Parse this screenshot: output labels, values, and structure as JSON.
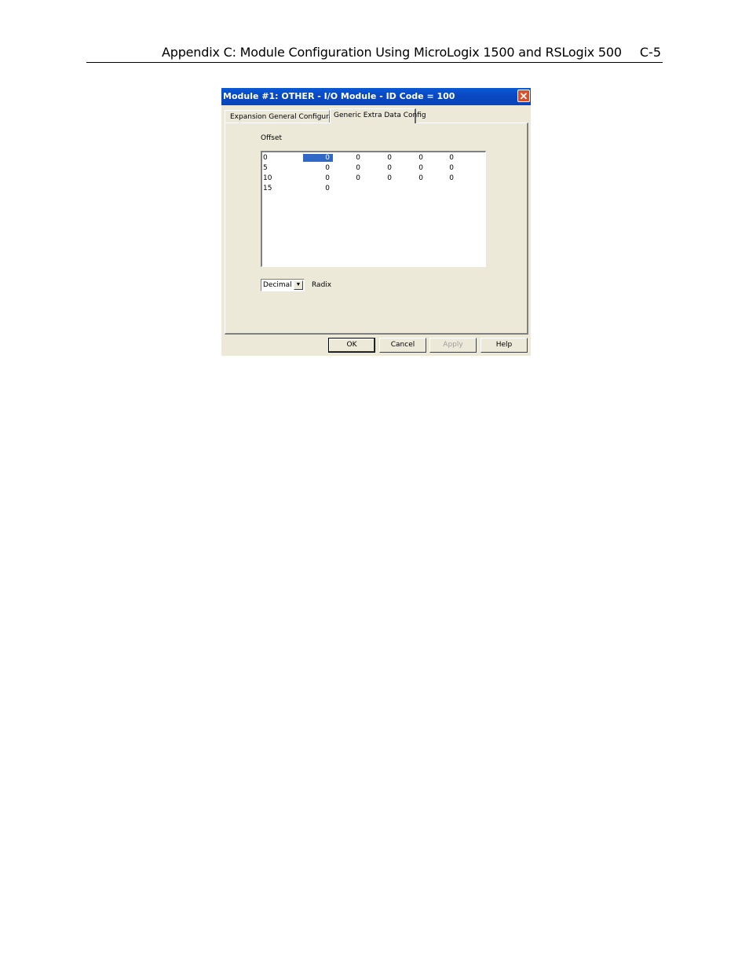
{
  "page": {
    "header_title": "Appendix C:  Module Configuration Using MicroLogix 1500 and RSLogix 500",
    "page_number": "C-5"
  },
  "dialog": {
    "title": "Module #1: OTHER - I/O Module - ID Code = 100",
    "close_symbol": "✕",
    "tabs": [
      {
        "label": "Expansion General Configuration",
        "active": false
      },
      {
        "label": "Generic Extra Data Config",
        "active": true
      }
    ],
    "offset_label": "Offset",
    "rows": [
      {
        "offset": "0",
        "values": [
          "0",
          "0",
          "0",
          "0",
          "0"
        ]
      },
      {
        "offset": "5",
        "values": [
          "0",
          "0",
          "0",
          "0",
          "0"
        ]
      },
      {
        "offset": "10",
        "values": [
          "0",
          "0",
          "0",
          "0",
          "0"
        ]
      },
      {
        "offset": "15",
        "values": [
          "0"
        ]
      }
    ],
    "radix_value": "Decimal",
    "radix_label": "Radix",
    "buttons": {
      "ok": "OK",
      "cancel": "Cancel",
      "apply": "Apply",
      "help": "Help"
    }
  }
}
